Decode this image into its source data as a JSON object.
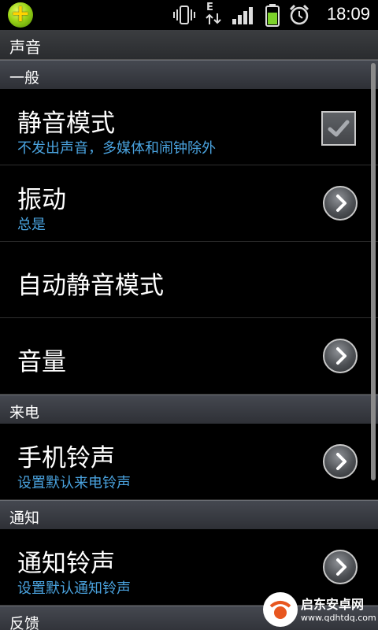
{
  "statusbar": {
    "time": "18:09",
    "network_label": "E",
    "icons": [
      "app-icon",
      "vibrate-icon",
      "data-transfer-icon",
      "signal-icon",
      "battery-icon",
      "alarm-icon"
    ]
  },
  "header": {
    "title": "声音"
  },
  "sections": {
    "general": {
      "label": "一般",
      "silent_mode": {
        "title": "静音模式",
        "subtitle": "不发出声音，多媒体和闹钟除外",
        "checked": true
      },
      "vibrate": {
        "title": "振动",
        "subtitle": "总是"
      },
      "auto_silent": {
        "title": "自动静音模式"
      },
      "volume": {
        "title": "音量"
      }
    },
    "incoming": {
      "label": "来电",
      "ringtone": {
        "title": "手机铃声",
        "subtitle": "设置默认来电铃声"
      }
    },
    "notification": {
      "label": "通知",
      "ringtone": {
        "title": "通知铃声",
        "subtitle": "设置默认通知铃声"
      }
    },
    "feedback": {
      "label": "反馈"
    }
  },
  "watermark": {
    "title": "启东安卓网",
    "url": "www.qdhtdq.com"
  },
  "colors": {
    "accent": "#4aa3df",
    "background": "#000000",
    "section_bg": "#3a3c42"
  }
}
